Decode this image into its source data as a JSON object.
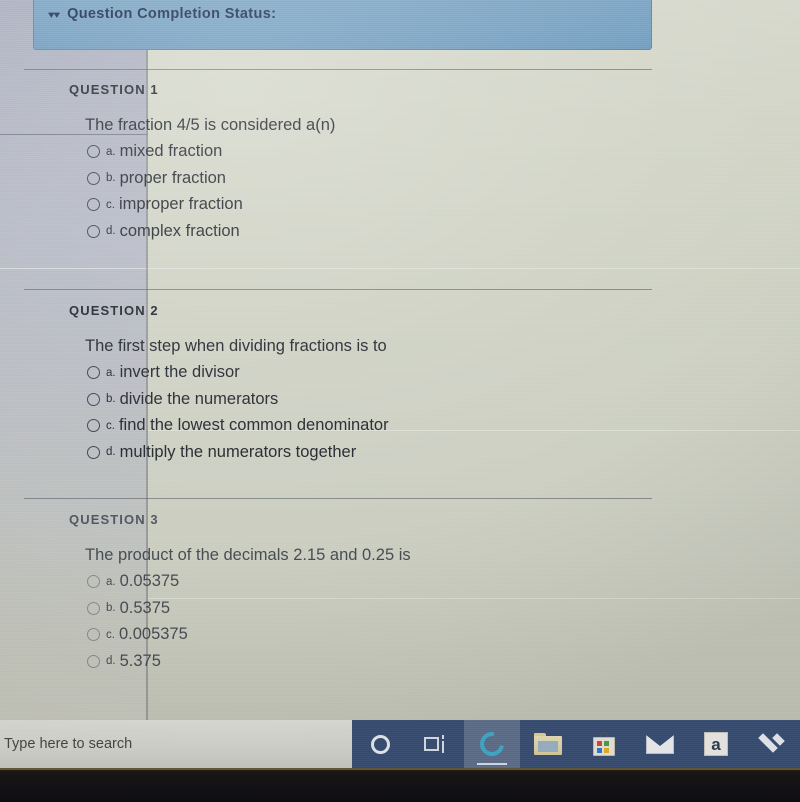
{
  "banner": {
    "collapse_icon": "chevron-double-down-icon",
    "title": "Question Completion Status:"
  },
  "questions": [
    {
      "heading": "QUESTION 1",
      "stem": "The fraction 4/5 is considered a(n)",
      "choices": [
        {
          "letter": "a.",
          "text": "mixed fraction",
          "selected": false
        },
        {
          "letter": "b.",
          "text": "proper fraction",
          "selected": false
        },
        {
          "letter": "c.",
          "text": "improper fraction",
          "selected": false
        },
        {
          "letter": "d.",
          "text": "complex fraction",
          "selected": false
        }
      ]
    },
    {
      "heading": "QUESTION 2",
      "stem": "The first step when dividing fractions is to",
      "choices": [
        {
          "letter": "a.",
          "text": "invert the divisor",
          "selected": false
        },
        {
          "letter": "b.",
          "text": "divide the numerators",
          "selected": false
        },
        {
          "letter": "c.",
          "text": "find the lowest common denominator",
          "selected": false
        },
        {
          "letter": "d.",
          "text": "multiply the numerators together",
          "selected": false
        }
      ]
    },
    {
      "heading": "QUESTION 3",
      "stem": "The product of the decimals 2.15 and 0.25 is",
      "choices": [
        {
          "letter": "a.",
          "text": "0.05375",
          "selected": false
        },
        {
          "letter": "b.",
          "text": "0.5375",
          "selected": false
        },
        {
          "letter": "c.",
          "text": "0.005375",
          "selected": false
        },
        {
          "letter": "d.",
          "text": "5.375",
          "selected": false
        }
      ]
    }
  ],
  "taskbar": {
    "search_placeholder": "Type here to search",
    "items": [
      {
        "icon": "cortana-icon",
        "label": "Cortana",
        "active": false
      },
      {
        "icon": "task-view-icon",
        "label": "Task View",
        "active": false
      },
      {
        "icon": "edge-browser-icon",
        "label": "Microsoft Edge",
        "active": true
      },
      {
        "icon": "file-explorer-icon",
        "label": "File Explorer",
        "active": false
      },
      {
        "icon": "microsoft-store-icon",
        "label": "Microsoft Store",
        "active": false
      },
      {
        "icon": "mail-icon",
        "label": "Mail",
        "active": false
      },
      {
        "icon": "amazon-icon",
        "label": "a",
        "active": false
      },
      {
        "icon": "dropbox-icon",
        "label": "Dropbox",
        "active": false
      }
    ]
  },
  "colors": {
    "banner_blue": "#74a0c2",
    "banner_text": "#1b2c4e",
    "content_bg": "#cfd2c3",
    "taskbar_blue": "#3c5276",
    "text": "#24282f"
  }
}
